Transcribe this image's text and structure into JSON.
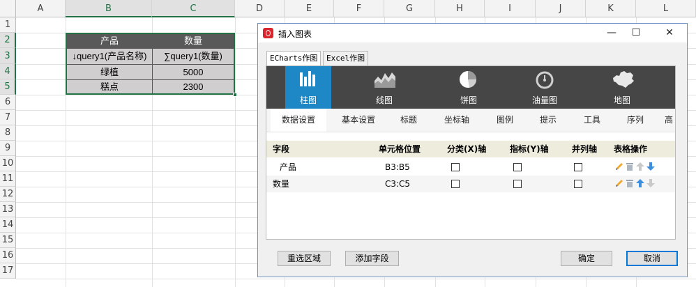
{
  "spreadsheet": {
    "columns": [
      "A",
      "B",
      "C",
      "D",
      "E",
      "F",
      "G",
      "H",
      "I",
      "J",
      "K",
      "L"
    ],
    "rows": [
      "1",
      "2",
      "3",
      "4",
      "5",
      "6",
      "7",
      "8",
      "9",
      "10",
      "11",
      "12",
      "13",
      "14",
      "15",
      "16",
      "17"
    ],
    "table": {
      "headers": [
        "产品",
        "数量"
      ],
      "rows": [
        [
          "↓query1(产品名称)",
          "∑query1(数量)"
        ],
        [
          "绿植",
          "5000"
        ],
        [
          "糕点",
          "2300"
        ]
      ]
    }
  },
  "dialog": {
    "title": "插入图表",
    "window_buttons": {
      "minimize": "—",
      "maximize": "☐",
      "close": "✕"
    },
    "top_tabs": [
      "ECharts作图",
      "Excel作图"
    ],
    "chart_types": [
      "柱图",
      "线图",
      "饼图",
      "油量图",
      "地图"
    ],
    "sub_tabs": [
      "数据设置",
      "基本设置",
      "标题",
      "坐标轴",
      "图例",
      "提示",
      "工具",
      "序列",
      "高"
    ],
    "field_table": {
      "headers": [
        "字段",
        "单元格位置",
        "分类(X)轴",
        "指标(Y)轴",
        "并列轴",
        "表格操作"
      ],
      "rows": [
        {
          "field": "产品",
          "cell": "B3:B5"
        },
        {
          "field": "数量",
          "cell": "C3:C5"
        }
      ]
    },
    "buttons": {
      "reselect": "重选区域",
      "add_field": "添加字段",
      "ok": "确定",
      "cancel": "取消"
    },
    "colors": {
      "accent": "#1e88c7",
      "chart_bar_bg": "#464646",
      "excel_green": "#217346"
    }
  }
}
